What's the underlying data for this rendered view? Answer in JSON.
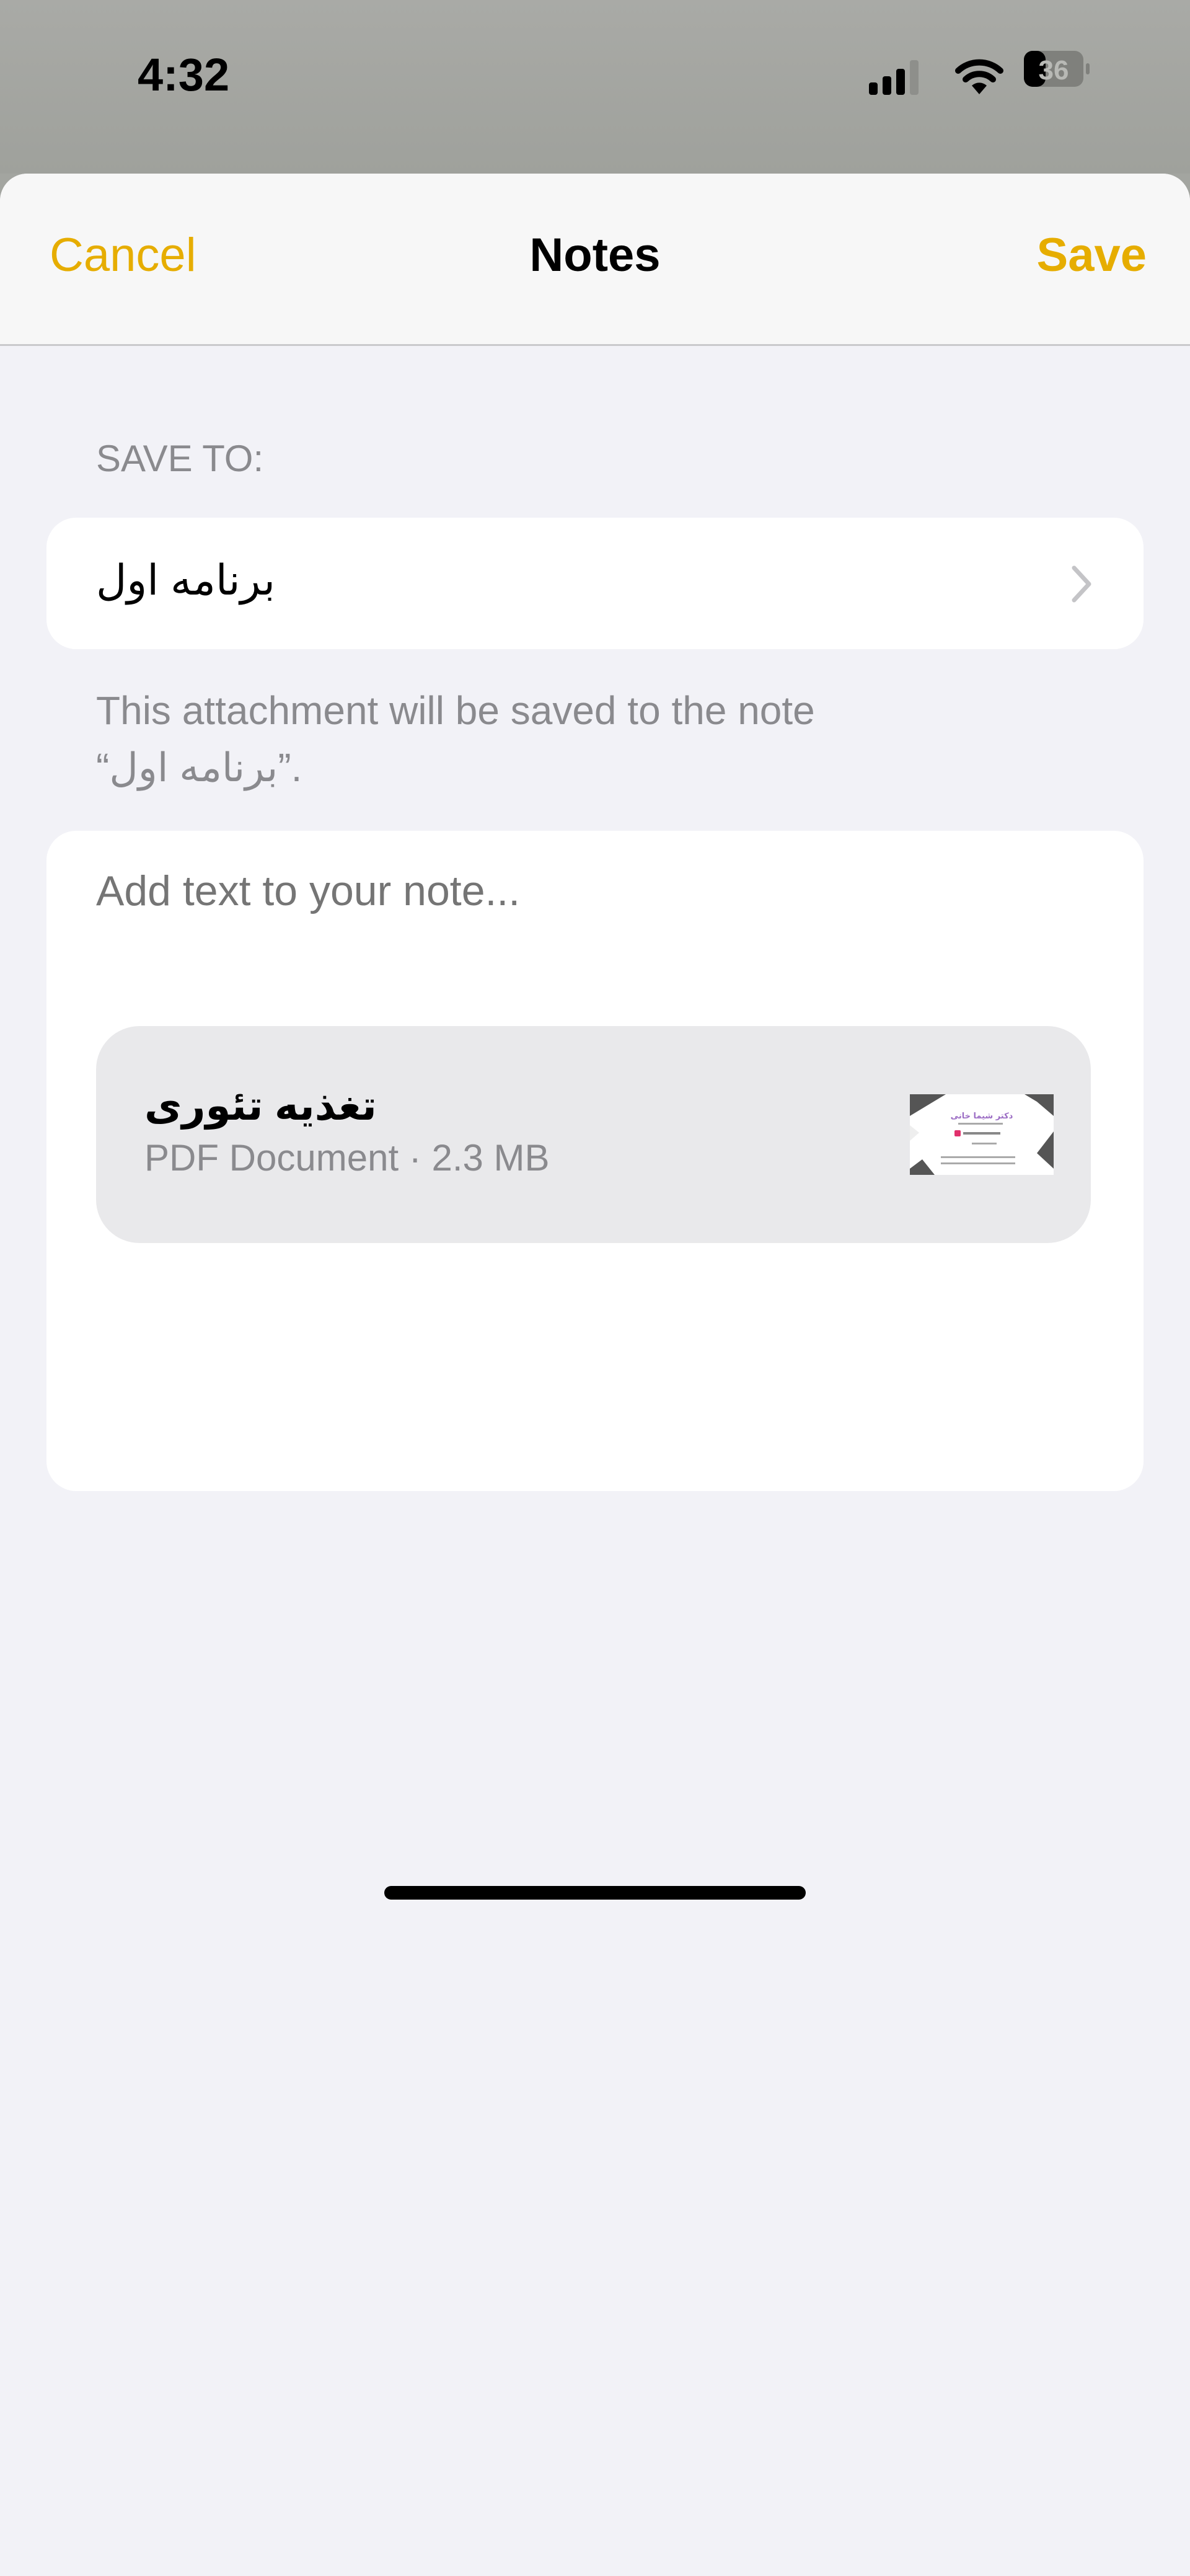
{
  "status_bar": {
    "time": "4:32",
    "battery": "36",
    "icons": [
      "cellular-signal-icon",
      "wifi-icon",
      "battery-icon"
    ]
  },
  "nav": {
    "cancel_label": "Cancel",
    "title": "Notes",
    "save_label": "Save",
    "accent_color": "#e6ad00"
  },
  "save_to": {
    "section_label": "SAVE TO:",
    "selected_note": "برنامه اول",
    "footer_line1": "This attachment will be saved to the note",
    "footer_line2": "“برنامه اول”."
  },
  "note": {
    "text_value": "",
    "placeholder": "Add text to your note...",
    "attachment": {
      "name": "تغذیه تئوری",
      "meta": "PDF Document · 2.3 MB",
      "thumbnail_text": "دکتر شیما خانی"
    }
  }
}
